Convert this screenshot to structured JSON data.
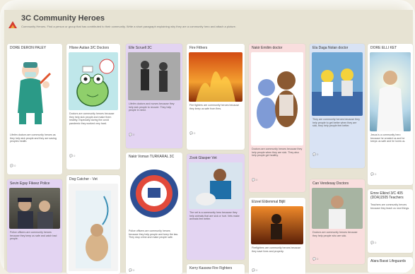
{
  "board": {
    "title": "3C Community Heroes",
    "description": "Community Heroes. Find a person or group that has contributed to their community. Write a short paragraph explaining why they are a community hero and attach a picture."
  },
  "cards": [
    {
      "title": "DORE DERON PALEY",
      "text": "Lifetim doctors are community heroes as they help sick people and they are saving peoples health.",
      "comments": "0"
    },
    {
      "title": "Hlone Autian 3/C Doctors",
      "text": "Doctors are community heroes because they help sick people and make them healthy. Especially during the covid pandemic they worked very hard.",
      "comments": "0"
    },
    {
      "title": "Elle Scruell 3C",
      "text": "Lifetim doctors and nurses because they help sick people to recover. They help people in need.",
      "comments": "0"
    },
    {
      "title": "Fire Fithers",
      "text": "Fire fighters are community heroes because they keep us safe from fires.",
      "comments": "0"
    },
    {
      "title": "Nakir Emilim doctor",
      "text": "Doctors are community heroes because they help people when they are sick. They also help people get healthy.",
      "comments": "0"
    },
    {
      "title": "Ela Daga Nolan doctor",
      "text": "They are community heroes because they help people to get better when they are sick, they help people feel better.",
      "comments": "0"
    },
    {
      "title": "DORE ELLI KET",
      "text": "Jesus is a community hero because he created us and he keeps us safe and he loves us.",
      "comments": "0"
    },
    {
      "title": "Sevin Egay Fikeez Police",
      "text": "Police officers are community heroes because they keep us safe and catch bad people.",
      "comments": "0"
    },
    {
      "title": "Dog Catcher - Vet",
      "text": "",
      "comments": ""
    },
    {
      "title": "Nakir Voman TURKARAL 3C",
      "text": "Police officers are community heroes because they help people and keep the law. They stop crime and make people safe.",
      "comments": "0"
    },
    {
      "title": "Zook Glasper Vet",
      "text": "The vet is a community hero because they help animals that are sick or hurt. Vets make animals feel better.",
      "comments": "0"
    },
    {
      "title": "Elzeel Eldemmal Bijlil",
      "text": "Firefighters are community heroes because they save lives and property.",
      "comments": "0"
    },
    {
      "title": "Can Vendesay Doctors",
      "text": "Doctors are community heroes because they help people who are sick.",
      "comments": "0"
    },
    {
      "title": "Emre Elkind 3/C 405 (DDA)1505 Teachers",
      "text": "Teachers are community heroes because they teach us new things.",
      "comments": "0"
    },
    {
      "title": "Kerry Kassow Fire Fighters",
      "text": "",
      "comments": ""
    },
    {
      "title": "Alara Bassi Lifeguards",
      "text": "",
      "comments": ""
    }
  ],
  "icons": {
    "logo": "padlet-logo-icon",
    "comment": "comment-icon"
  },
  "colors": {
    "board_bg": "#e7e3d3",
    "card_white": "#ffffff",
    "card_lavender": "#e3d4f2",
    "card_pink": "#f9dede",
    "card_blue": "#d9e3f4"
  }
}
